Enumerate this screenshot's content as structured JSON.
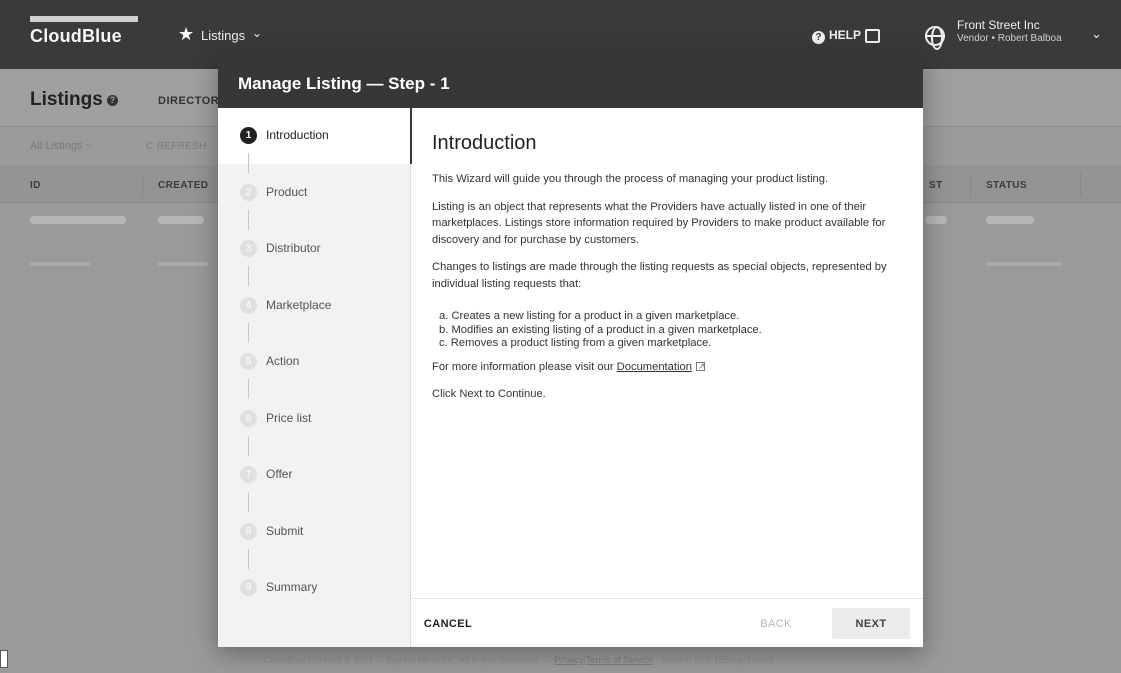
{
  "app": {
    "logo": "CloudBlue",
    "nav_title": "Listings",
    "help": "HELP",
    "account_name": "Front Street Inc",
    "account_sub": "Vendor • Robert Balboa"
  },
  "page": {
    "title": "Listings",
    "tab_directory": "DIRECTOR",
    "all_listings": "All Listings ~",
    "refresh": "C REFRESH",
    "columns": [
      "ID",
      "CREATED",
      "ST",
      "STATUS"
    ]
  },
  "footer": {
    "copyright": "CloudBlue Connect © 2021 — Ingram Micro Inc. All Rights Reserved. —",
    "privacy": "Privacy",
    "sep": "|",
    "terms": "Terms of Service",
    "version": "· Version 22.0.1850-gc1eocf6"
  },
  "modal": {
    "title": "Manage Listing — Step - 1",
    "steps": [
      {
        "num": "1",
        "label": "Introduction"
      },
      {
        "num": "2",
        "label": "Product"
      },
      {
        "num": "3",
        "label": "Distributor"
      },
      {
        "num": "4",
        "label": "Marketplace"
      },
      {
        "num": "5",
        "label": "Action"
      },
      {
        "num": "6",
        "label": "Price list"
      },
      {
        "num": "7",
        "label": "Offer"
      },
      {
        "num": "8",
        "label": "Submit"
      },
      {
        "num": "9",
        "label": "Summary"
      }
    ],
    "heading": "Introduction",
    "para1": "This Wizard will guide you through the process of managing your product listing.",
    "para2": "Listing is an object that represents what the Providers have actually listed in one of their marketplaces. Listings store information required by Providers to make product available for discovery and for purchase by customers.",
    "para3": "Changes to listings are made through the listing requests as special objects, represented by individual listing requests that:",
    "list": [
      "a. Creates a new listing for a product in a given marketplace.",
      "b. Modifies an existing listing of a product in a given marketplace.",
      "c. Removes a product listing from a given marketplace."
    ],
    "more_info": "For more information please visit our",
    "doc_link": "Documentation",
    "click_next": "Click Next to Continue.",
    "cancel": "CANCEL",
    "back": "BACK",
    "next": "NEXT"
  }
}
